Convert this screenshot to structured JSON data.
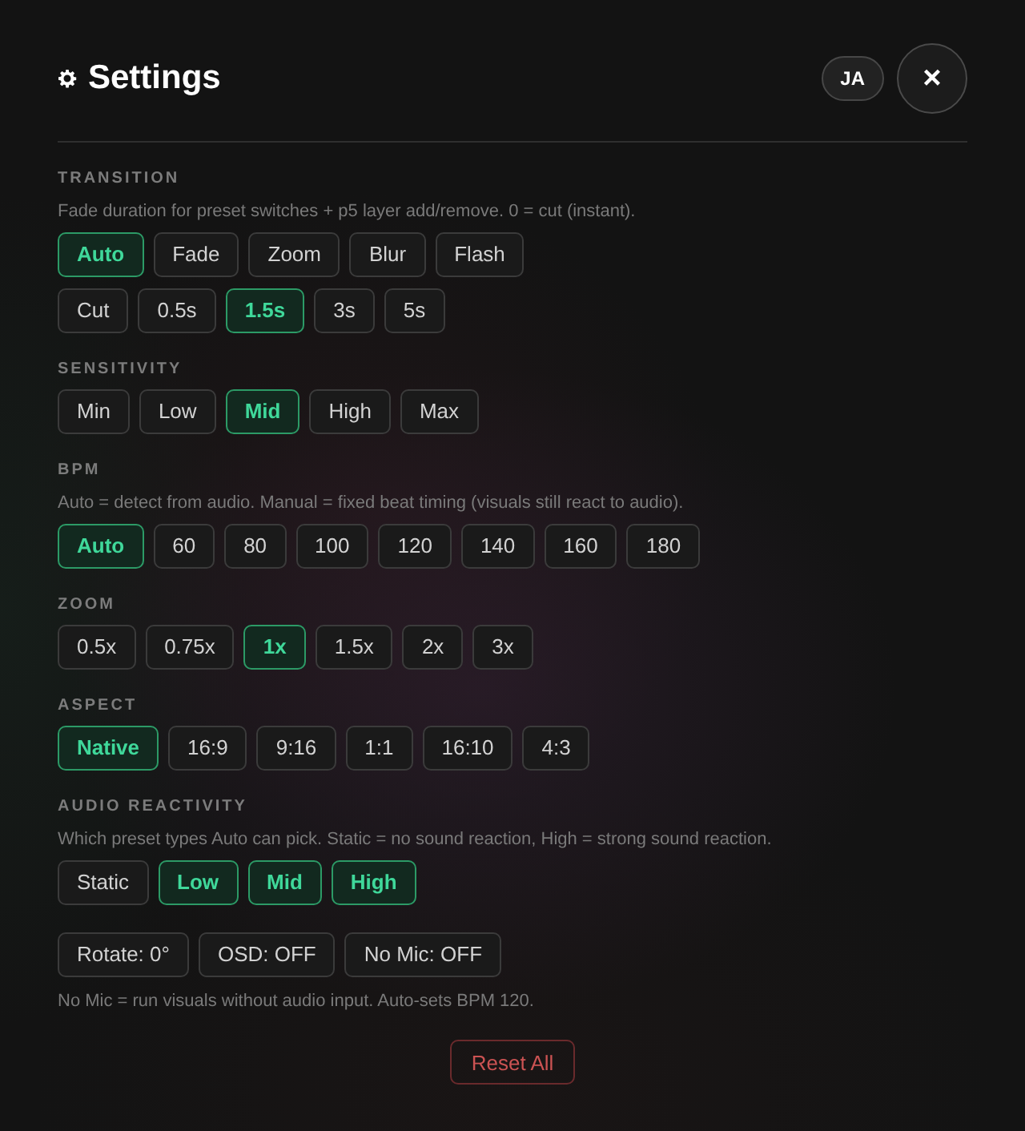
{
  "header": {
    "title": "Settings",
    "language_button": "JA",
    "close_button": "×"
  },
  "sections": [
    {
      "label": "TRANSITION",
      "description": "Fade duration for preset switches + p5 layer add/remove. 0 = cut (instant).",
      "rows": [
        [
          {
            "label": "Auto",
            "selected": true
          },
          {
            "label": "Fade",
            "selected": false
          },
          {
            "label": "Zoom",
            "selected": false
          },
          {
            "label": "Blur",
            "selected": false
          },
          {
            "label": "Flash",
            "selected": false
          }
        ],
        [
          {
            "label": "Cut",
            "selected": false
          },
          {
            "label": "0.5s",
            "selected": false
          },
          {
            "label": "1.5s",
            "selected": true
          },
          {
            "label": "3s",
            "selected": false
          },
          {
            "label": "5s",
            "selected": false
          }
        ]
      ]
    },
    {
      "label": "SENSITIVITY",
      "rows": [
        [
          {
            "label": "Min",
            "selected": false
          },
          {
            "label": "Low",
            "selected": false
          },
          {
            "label": "Mid",
            "selected": true
          },
          {
            "label": "High",
            "selected": false
          },
          {
            "label": "Max",
            "selected": false
          }
        ]
      ]
    },
    {
      "label": "BPM",
      "description": "Auto = detect from audio. Manual = fixed beat timing (visuals still react to audio).",
      "rows": [
        [
          {
            "label": "Auto",
            "selected": true
          },
          {
            "label": "60",
            "selected": false
          },
          {
            "label": "80",
            "selected": false
          },
          {
            "label": "100",
            "selected": false
          },
          {
            "label": "120",
            "selected": false
          },
          {
            "label": "140",
            "selected": false
          },
          {
            "label": "160",
            "selected": false
          },
          {
            "label": "180",
            "selected": false
          }
        ]
      ]
    },
    {
      "label": "ZOOM",
      "rows": [
        [
          {
            "label": "0.5x",
            "selected": false
          },
          {
            "label": "0.75x",
            "selected": false
          },
          {
            "label": "1x",
            "selected": true
          },
          {
            "label": "1.5x",
            "selected": false
          },
          {
            "label": "2x",
            "selected": false
          },
          {
            "label": "3x",
            "selected": false
          }
        ]
      ]
    },
    {
      "label": "ASPECT",
      "rows": [
        [
          {
            "label": "Native",
            "selected": true
          },
          {
            "label": "16:9",
            "selected": false
          },
          {
            "label": "9:16",
            "selected": false
          },
          {
            "label": "1:1",
            "selected": false
          },
          {
            "label": "16:10",
            "selected": false
          },
          {
            "label": "4:3",
            "selected": false
          }
        ]
      ]
    },
    {
      "label": "AUDIO REACTIVITY",
      "description": "Which preset types Auto can pick. Static = no sound reaction, High = strong sound reaction.",
      "rows": [
        [
          {
            "label": "Static",
            "selected": false
          },
          {
            "label": "Low",
            "selected": true
          },
          {
            "label": "Mid",
            "selected": true
          },
          {
            "label": "High",
            "selected": true
          }
        ]
      ]
    }
  ],
  "toggles": [
    "Rotate: 0°",
    "OSD: OFF",
    "No Mic: OFF"
  ],
  "note": "No Mic = run visuals without audio input. Auto-sets BPM 120.",
  "reset_button": "Reset All"
}
